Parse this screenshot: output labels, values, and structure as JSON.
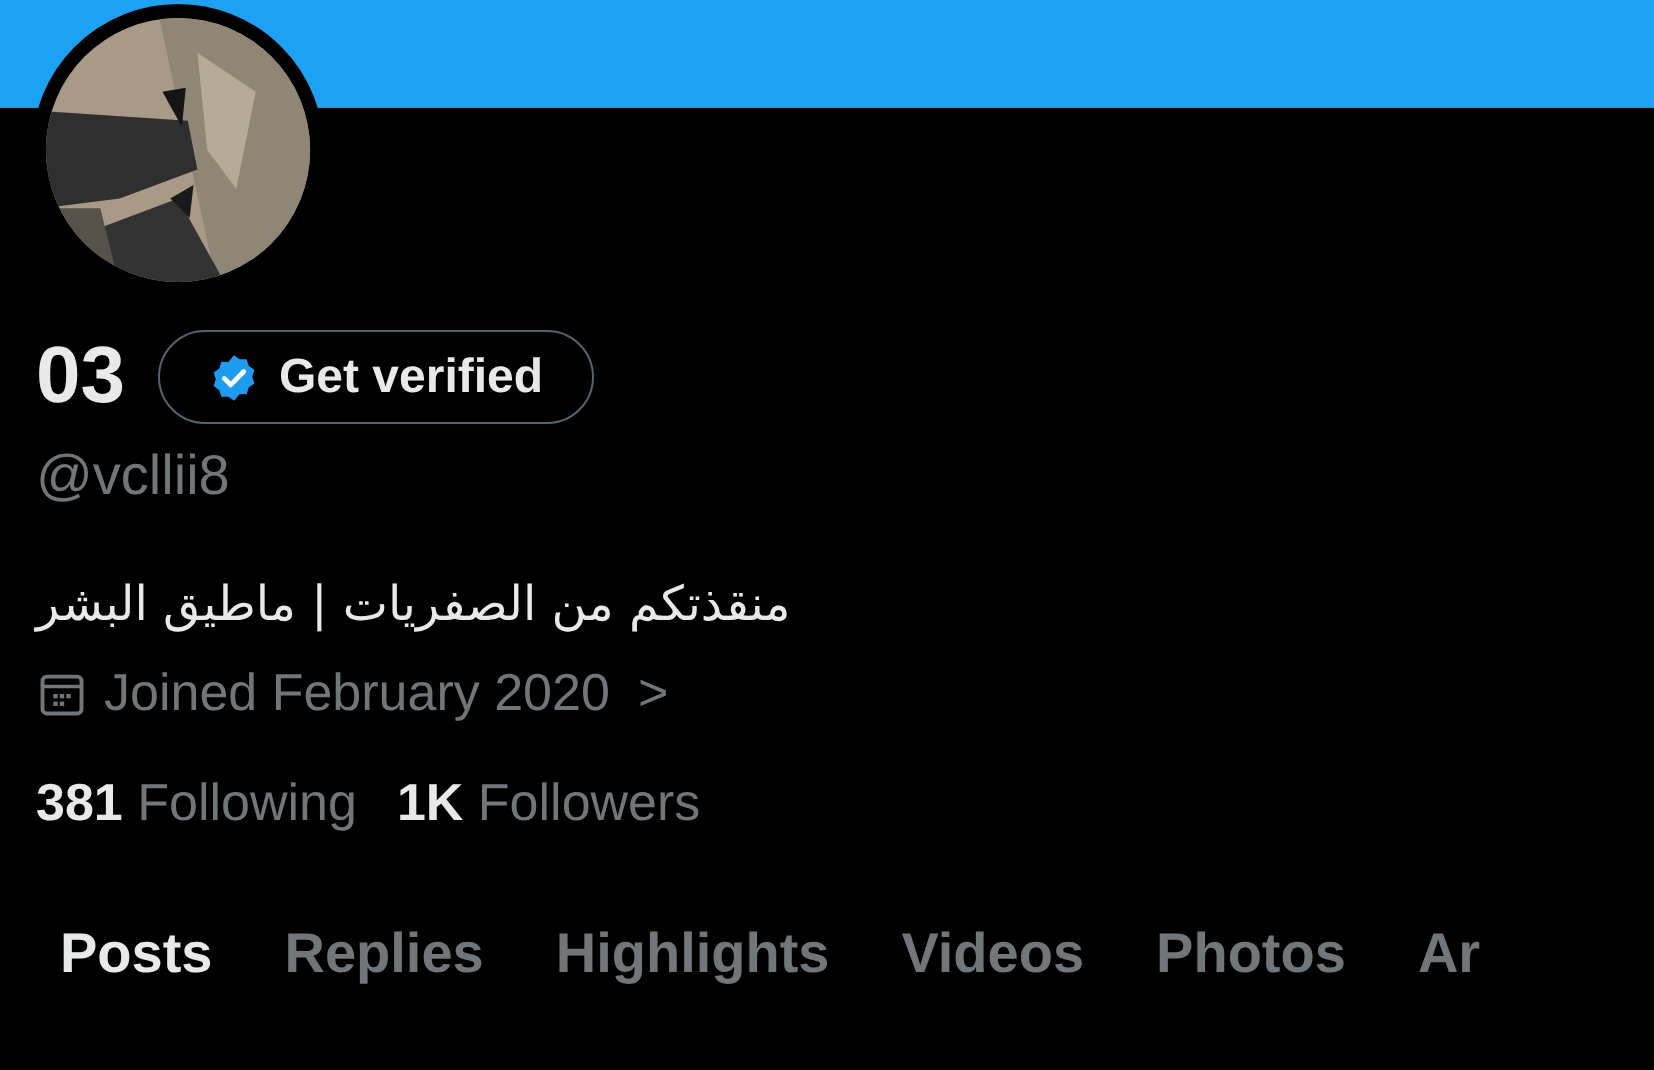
{
  "profile": {
    "name": "03",
    "verify_button": "Get verified",
    "handle": "@vcllii8",
    "bio": "منقذتكم من الصفريات | ماطيق البشر",
    "joined": "Joined February 2020",
    "chevron": ">"
  },
  "stats": [
    {
      "count": "381",
      "label": "Following"
    },
    {
      "count": "1K",
      "label": "Followers"
    }
  ],
  "tabs": [
    {
      "label": "Posts",
      "selected": true
    },
    {
      "label": "Replies",
      "selected": false
    },
    {
      "label": "Highlights",
      "selected": false
    },
    {
      "label": "Videos",
      "selected": false
    },
    {
      "label": "Photos",
      "selected": false
    },
    {
      "label": "Ar",
      "selected": false
    }
  ]
}
